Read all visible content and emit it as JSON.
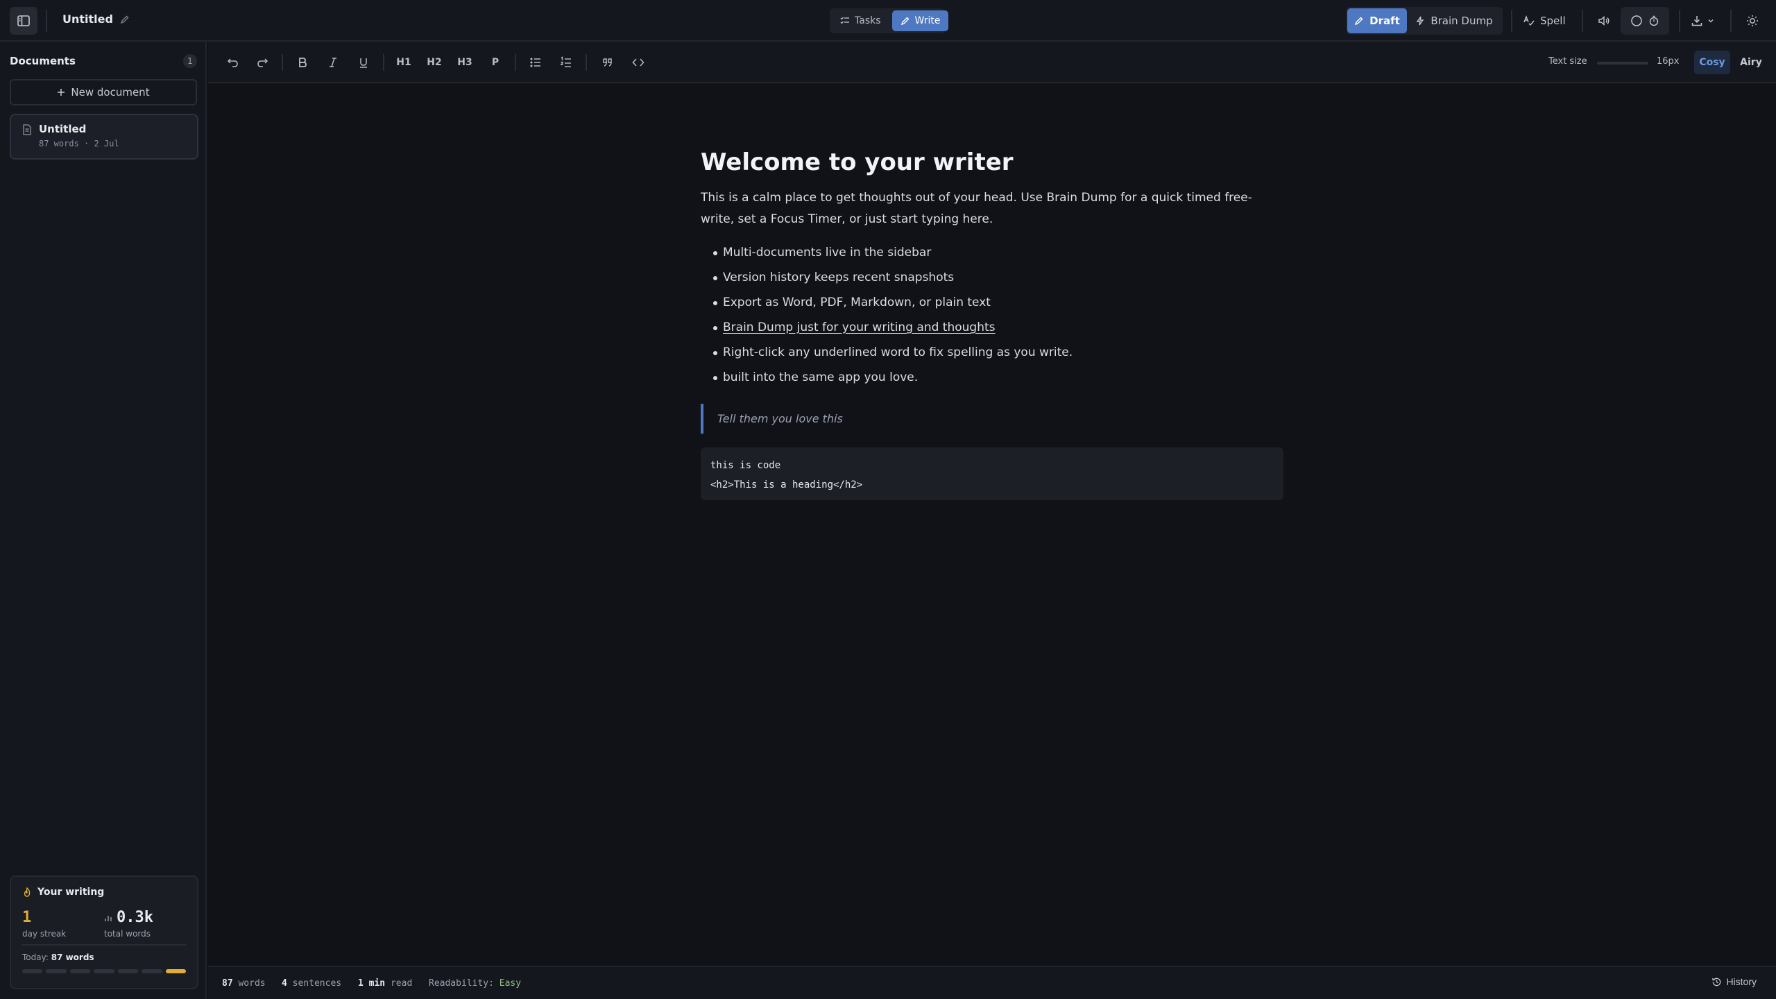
{
  "header": {
    "doc_title": "Untitled",
    "modes": [
      {
        "label": "Tasks",
        "active": false
      },
      {
        "label": "Write",
        "active": true
      }
    ],
    "draft_label": "Draft",
    "brain_dump_label": "Brain Dump",
    "spell_label": "Spell"
  },
  "sidebar": {
    "title": "Documents",
    "count": "1",
    "new_document_label": "New document",
    "documents": [
      {
        "name": "Untitled",
        "meta": "87 words · 2 Jul"
      }
    ],
    "stats": {
      "title": "Your writing",
      "streak_value": "1",
      "streak_label": "day streak",
      "total_value": "0.3k",
      "total_label": "total words",
      "today_label": "Today:",
      "today_value": "87 words",
      "week_active": [
        false,
        false,
        false,
        false,
        false,
        false,
        true
      ]
    }
  },
  "toolbar": {
    "h1": "H1",
    "h2": "H2",
    "h3": "H3",
    "p": "P",
    "text_size_label": "Text size",
    "text_size_value": "16px",
    "text_size_fraction": 0.0,
    "density_cosy": "Cosy",
    "density_airy": "Airy"
  },
  "document": {
    "heading": "Welcome to your writer",
    "intro": "This is a calm place to get thoughts out of your head. Use Brain Dump for a quick timed free-write, set a Focus Timer, or just start typing here.",
    "bullets": [
      "Multi-documents live in the sidebar",
      "Version history keeps recent snapshots",
      "Export as Word, PDF, Markdown, or plain text",
      "Brain Dump just for your writing and thoughts",
      "Right-click any underlined word to fix spelling as you write.",
      "built into the same app you love."
    ],
    "quote": "Tell them you love this",
    "code_lines": [
      "this is code",
      "<h2>This is a heading</h2>"
    ]
  },
  "status": {
    "words_value": "87",
    "words_label": "words",
    "sentences_value": "4",
    "sentences_label": "sentences",
    "read_value": "1 min",
    "read_label": "read",
    "readability_label": "Readability:",
    "readability_value": "Easy",
    "history_label": "History"
  },
  "colors": {
    "accent": "#4f78c2",
    "streak": "#e0ad35",
    "readability_easy": "#8fc27a"
  }
}
